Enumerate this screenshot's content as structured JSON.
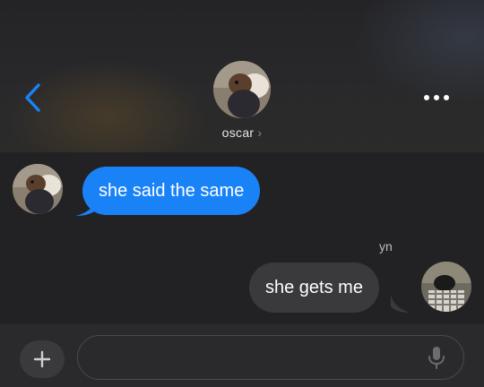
{
  "header": {
    "back_icon": "chevron-left-icon",
    "more_icon": "ellipsis-icon",
    "contact_name": "oscar",
    "contact_chevron": "›",
    "accent_color": "#1a82f7"
  },
  "messages": [
    {
      "direction": "incoming",
      "text": "she said the same",
      "bubble_color": "#1a82f7"
    },
    {
      "direction": "outgoing",
      "sender": "yn",
      "text": "she gets me",
      "bubble_color": "#3a3a3c"
    }
  ],
  "composer": {
    "plus_icon": "plus-icon",
    "input_value": "",
    "input_placeholder": "",
    "mic_icon": "microphone-icon"
  }
}
